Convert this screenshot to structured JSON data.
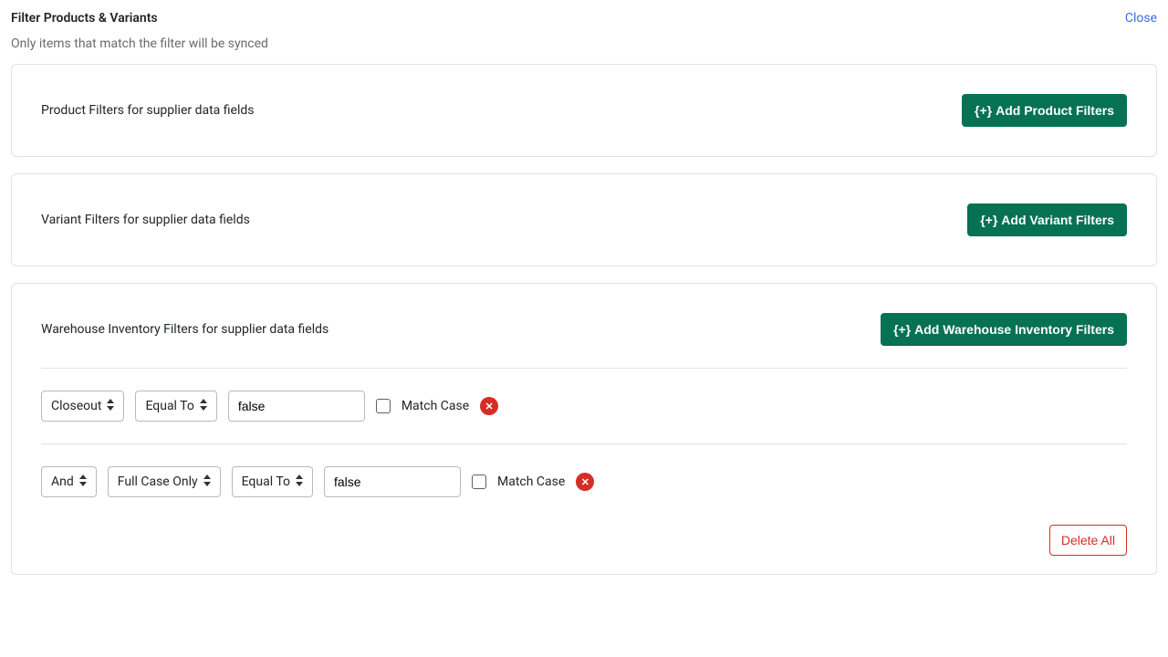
{
  "header": {
    "title": "Filter Products & Variants",
    "close": "Close",
    "subtitle": "Only items that match the filter will be synced"
  },
  "sections": {
    "product": {
      "label": "Product Filters for supplier data fields",
      "add_btn": "Add Product Filters"
    },
    "variant": {
      "label": "Variant Filters for supplier data fields",
      "add_btn": "Add Variant Filters"
    },
    "warehouse": {
      "label": "Warehouse Inventory Filters for supplier data fields",
      "add_btn": "Add Warehouse Inventory Filters",
      "rules": [
        {
          "field": "Closeout",
          "operator": "Equal To",
          "value": "false",
          "match_case_label": "Match Case",
          "match_case_checked": false
        },
        {
          "conjunction": "And",
          "field": "Full Case Only",
          "operator": "Equal To",
          "value": "false",
          "match_case_label": "Match Case",
          "match_case_checked": false
        }
      ],
      "delete_all": "Delete All"
    }
  },
  "icons": {
    "plus_brace": "{+}",
    "x": "✕"
  }
}
